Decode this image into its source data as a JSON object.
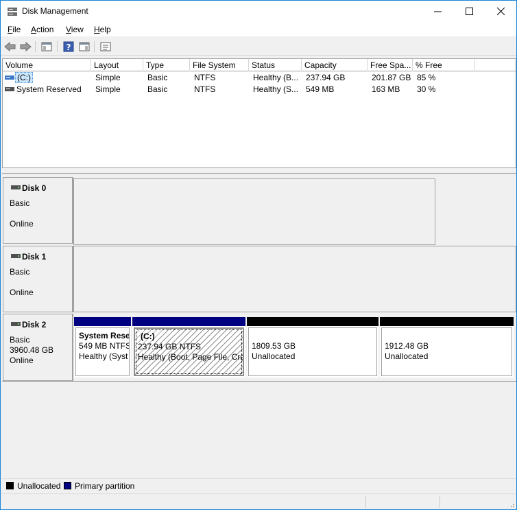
{
  "window": {
    "title": "Disk Management"
  },
  "menu": {
    "items": [
      {
        "pre": "",
        "u": "F",
        "post": "ile"
      },
      {
        "pre": "",
        "u": "A",
        "post": "ction"
      },
      {
        "pre": "",
        "u": "V",
        "post": "iew"
      },
      {
        "pre": "",
        "u": "H",
        "post": "elp"
      }
    ]
  },
  "toolbar": {
    "icons": [
      "back-icon",
      "forward-icon",
      "console-tree-icon",
      "help-icon",
      "action-pane-icon",
      "properties-icon"
    ]
  },
  "volumes": {
    "columns": [
      "Volume",
      "Layout",
      "Type",
      "File System",
      "Status",
      "Capacity",
      "Free Spa...",
      "% Free"
    ],
    "rows": [
      {
        "volume": "(C:)",
        "layout": "Simple",
        "type": "Basic",
        "fs": "NTFS",
        "status": "Healthy (B...",
        "capacity": "237.94 GB",
        "free": "201.87 GB",
        "pct": "85 %"
      },
      {
        "volume": "System Reserved",
        "layout": "Simple",
        "type": "Basic",
        "fs": "NTFS",
        "status": "Healthy (S...",
        "capacity": "549 MB",
        "free": "163 MB",
        "pct": "30 %"
      }
    ]
  },
  "disks": [
    {
      "name": "Disk 0",
      "type": "Basic",
      "size": "",
      "state": "Online"
    },
    {
      "name": "Disk 1",
      "type": "Basic",
      "size": "",
      "state": "Online"
    },
    {
      "name": "Disk 2",
      "type": "Basic",
      "size": "3960.48 GB",
      "state": "Online"
    }
  ],
  "partitions": [
    {
      "name": "System Rese",
      "line1": "549 MB NTFS",
      "line2": "Healthy (Syst",
      "kind": "primary"
    },
    {
      "name": "(C:)",
      "line1": "237.94 GB NTFS",
      "line2": "Healthy (Boot, Page File, Cra",
      "kind": "primary"
    },
    {
      "name": "",
      "line1": "1809.53 GB",
      "line2": "Unallocated",
      "kind": "unallocated"
    },
    {
      "name": "",
      "line1": "1912.48 GB",
      "line2": "Unallocated",
      "kind": "unallocated"
    }
  ],
  "legend": [
    {
      "label": "Unallocated",
      "color": "#000000"
    },
    {
      "label": "Primary partition",
      "color": "#000080"
    }
  ],
  "colors": {
    "primary": "#000080",
    "unallocated": "#000000",
    "selection": "#cce8ff"
  }
}
